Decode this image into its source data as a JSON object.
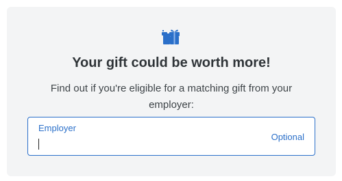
{
  "card": {
    "icon": "gift-icon",
    "title": "Your gift could be worth more!",
    "description": "Find out if you're eligible for a matching gift from your employer:",
    "employer_field": {
      "label": "Employer",
      "value": "",
      "optional_text": "Optional"
    }
  },
  "colors": {
    "accent": "#2a6fc9",
    "card_background": "#f3f4f5",
    "title_text": "#2f3438"
  }
}
